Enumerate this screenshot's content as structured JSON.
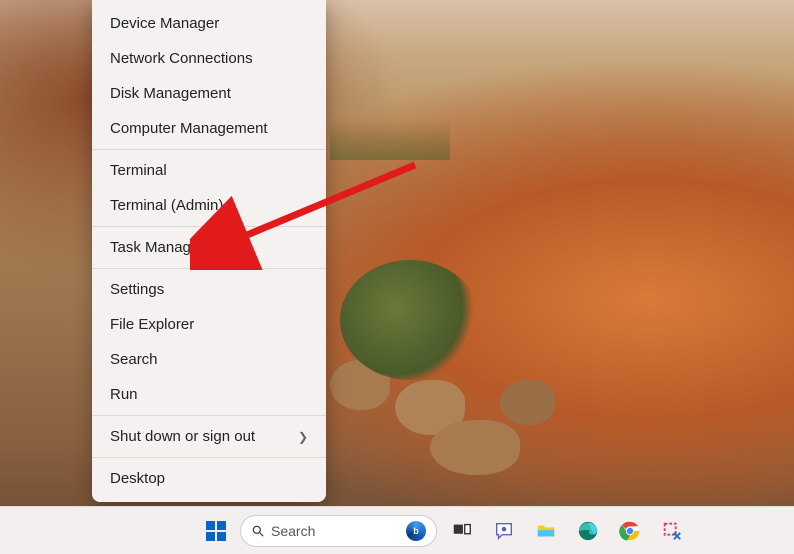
{
  "context_menu": {
    "groups": [
      [
        "Device Manager",
        "Network Connections",
        "Disk Management",
        "Computer Management"
      ],
      [
        "Terminal",
        "Terminal (Admin)"
      ],
      [
        "Task Manager"
      ],
      [
        "Settings",
        "File Explorer",
        "Search",
        "Run"
      ],
      [
        "Shut down or sign out"
      ],
      [
        "Desktop"
      ]
    ],
    "submenu_items": [
      "Shut down or sign out"
    ]
  },
  "annotation_arrow": {
    "description": "Red arrow pointing to Task Manager",
    "target": "Task Manager",
    "color": "#e11b1b"
  },
  "taskbar": {
    "search_placeholder": "Search",
    "icons": [
      "start",
      "search",
      "bing",
      "task-view",
      "chat",
      "file-explorer",
      "edge",
      "chrome",
      "snipping-tool"
    ]
  }
}
